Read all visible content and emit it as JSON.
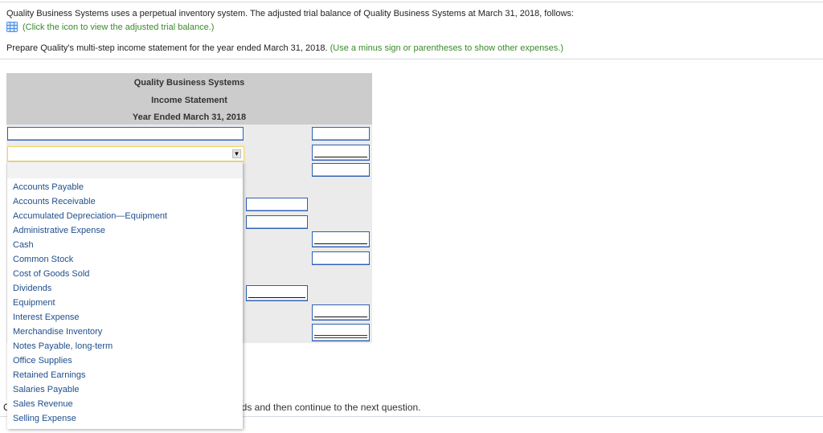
{
  "instructions": {
    "intro": "Quality Business Systems uses a perpetual inventory system. The adjusted trial balance of Quality Business Systems at March 31, 2018, follows:",
    "icon_link": "(Click the icon to view the adjusted trial balance.)",
    "task": "Prepare Quality's multi-step income statement for the year ended March 31, 2018.",
    "task_hint": "(Use a minus sign or parentheses to show other expenses.)"
  },
  "statement_header": {
    "company": "Quality Business Systems",
    "title": "Income Statement",
    "period": "Year Ended March 31, 2018"
  },
  "form": {
    "first_label_value": "",
    "select_value": "",
    "amount_inputs": [
      "",
      "",
      "",
      "",
      "",
      "",
      "",
      "",
      "",
      "",
      ""
    ]
  },
  "dropdown": {
    "options": [
      "Accounts Payable",
      "Accounts Receivable",
      "Accumulated Depreciation—Equipment",
      "Administrative Expense",
      "Cash",
      "Common Stock",
      "Cost of Goods Sold",
      "Dividends",
      "Equipment",
      "Interest Expense",
      "Merchandise Inventory",
      "Notes Payable, long-term",
      "Office Supplies",
      "Retained Earnings",
      "Salaries Payable",
      "Sales Revenue",
      "Selling Expense"
    ]
  },
  "footer": {
    "leading_char": "C",
    "visible_text": "lds and then continue to the next question."
  },
  "colors": {
    "hint_green": "#3a8a2a",
    "link_blue": "#1f4e8c",
    "input_border": "#2f5fb3",
    "focus_yellow": "#f2d46a"
  }
}
